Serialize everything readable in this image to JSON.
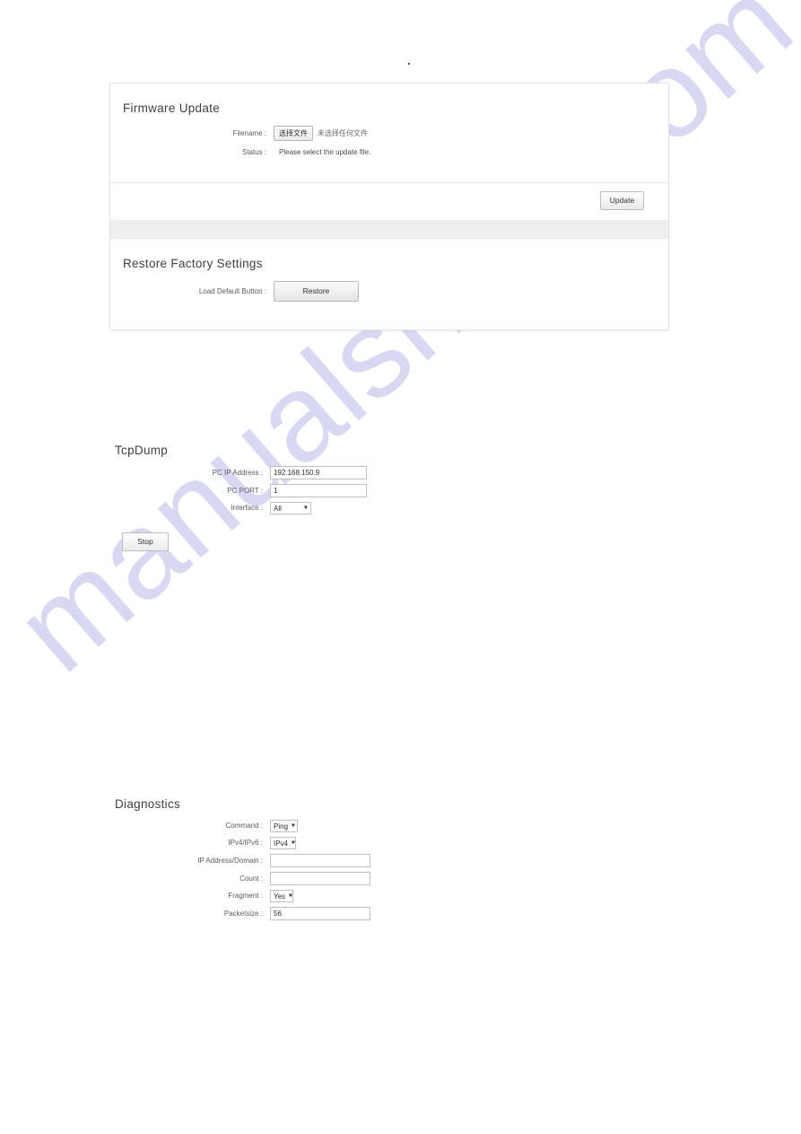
{
  "page": {
    "dot_mark": "."
  },
  "watermark": {
    "text": "manualshive.com",
    "color": "#d8d6f2"
  },
  "firmware_update": {
    "title": "Firmware Update",
    "filename_label": "Filename :",
    "file_choose_button": "选择文件",
    "file_none_selected": "未选择任何文件",
    "status_label": "Status :",
    "status_value": "Please select the update file.",
    "update_button": "Update"
  },
  "restore_factory_settings": {
    "title": "Restore Factory Settings",
    "load_default_label": "Load Default Button :",
    "restore_button": "Restore"
  },
  "tcpdump": {
    "title": "TcpDump",
    "pc_ip_label": "PC IP Address :",
    "pc_ip_value": "192.168.150.9",
    "pc_port_label": "PC PORT :",
    "pc_port_value": "1",
    "interface_label": "Interface :",
    "interface_value": "All",
    "stop_button": "Stop",
    "caret": "▼"
  },
  "diagnostics": {
    "title": "Diagnostics",
    "command_label": "Command :",
    "command_value": "Ping",
    "ipversion_label": "IPv4/IPv6 :",
    "ipversion_value": "IPv4",
    "address_label": "IP Address/Domain :",
    "address_value": "",
    "count_label": "Count :",
    "count_value": "",
    "fragment_label": "Fragment :",
    "fragment_value": "Yes",
    "packetsize_label": "Packetsize :",
    "packetsize_value": "56",
    "caret": "▼"
  }
}
